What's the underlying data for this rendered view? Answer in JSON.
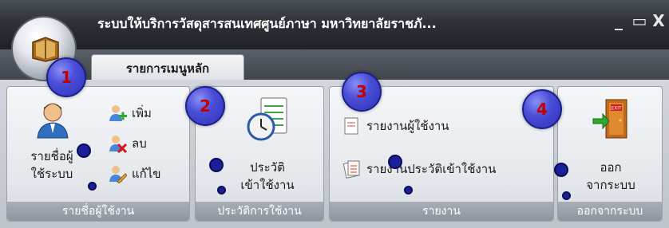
{
  "window": {
    "title": "ระบบให้บริการวัสดุสารสนเทศศูนย์ภาษา มหาวิทยาลัยราชภั...",
    "controls": {
      "minimize": "_",
      "maximize": "▭",
      "close": "X"
    }
  },
  "tabs": [
    {
      "label": "รายการเมนูหลัก"
    }
  ],
  "ribbon": {
    "group_user": {
      "label": "รายชื่อผู้ใช้งาน",
      "big_button": "รายชื่อผู้ใช้ระบบ",
      "big_line1": "รายชื่อผู้",
      "big_line2": "ใช้ระบบ",
      "add": "เพิ่ม",
      "delete": "ลบ",
      "edit": "แก้ไข"
    },
    "group_history": {
      "label": "ประวัติการใช้งาน",
      "line1": "ประวัติ",
      "line2": "เข้าใช้งาน"
    },
    "group_report": {
      "label": "รายงาน",
      "report_users": "รายงานผู้ใช้งาน",
      "report_history": "รายงานประวัติเข้าใช้งาน"
    },
    "group_exit": {
      "label": "ออกจากระบบ",
      "line1": "ออก",
      "line2": "จากระบบ"
    }
  },
  "markers": [
    "1",
    "2",
    "3",
    "4"
  ],
  "icons": {
    "orb": "book-icon",
    "users": "user-list-icon",
    "add": "add-user-icon",
    "delete": "delete-user-icon",
    "edit": "edit-user-icon",
    "history": "clock-notepad-icon",
    "report": "report-icon",
    "exit": "exit-door-icon"
  },
  "colors": {
    "titlebar": "#2e3238",
    "marker": "#4b4fd8",
    "marker_text": "#c40000",
    "group_label": "#9aa1aa"
  }
}
